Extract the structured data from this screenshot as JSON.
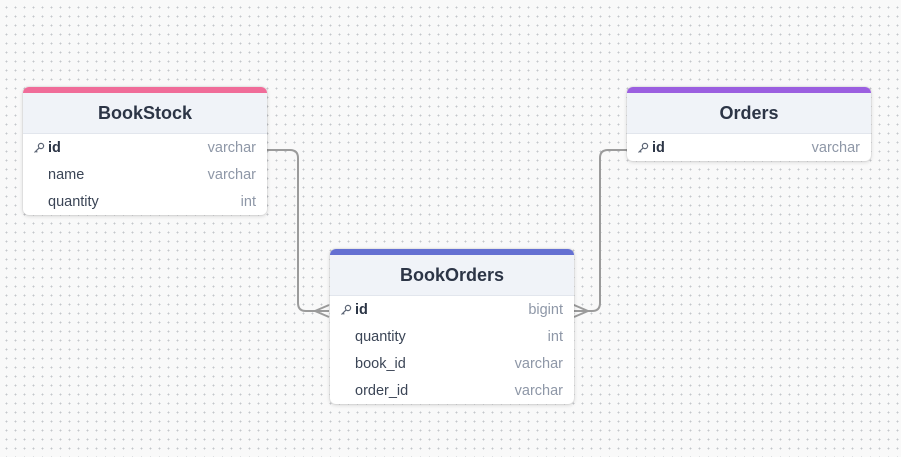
{
  "canvas": {
    "background": "#f9f9f9",
    "dot_color": "#c4c6ca",
    "edge_color": "#9b9b9b"
  },
  "tables": {
    "bookstock": {
      "title": "BookStock",
      "accent": "#f06c99",
      "columns": [
        {
          "name": "id",
          "type": "varchar",
          "pk": true,
          "icon": "key-icon"
        },
        {
          "name": "name",
          "type": "varchar",
          "pk": false
        },
        {
          "name": "quantity",
          "type": "int",
          "pk": false
        }
      ]
    },
    "orders": {
      "title": "Orders",
      "accent": "#9b5fe0",
      "columns": [
        {
          "name": "id",
          "type": "varchar",
          "pk": true,
          "icon": "key-icon"
        }
      ]
    },
    "bookorders": {
      "title": "BookOrders",
      "accent": "#6470d2",
      "columns": [
        {
          "name": "id",
          "type": "bigint",
          "pk": true,
          "icon": "key-icon"
        },
        {
          "name": "quantity",
          "type": "int",
          "pk": false
        },
        {
          "name": "book_id",
          "type": "varchar",
          "pk": false
        },
        {
          "name": "order_id",
          "type": "varchar",
          "pk": false
        }
      ]
    }
  },
  "relations": [
    {
      "from": "BookStock.id",
      "to": "BookOrders.id",
      "from_cardinality": "one",
      "to_cardinality": "many"
    },
    {
      "from": "Orders.id",
      "to": "BookOrders.id",
      "from_cardinality": "one",
      "to_cardinality": "many"
    }
  ]
}
